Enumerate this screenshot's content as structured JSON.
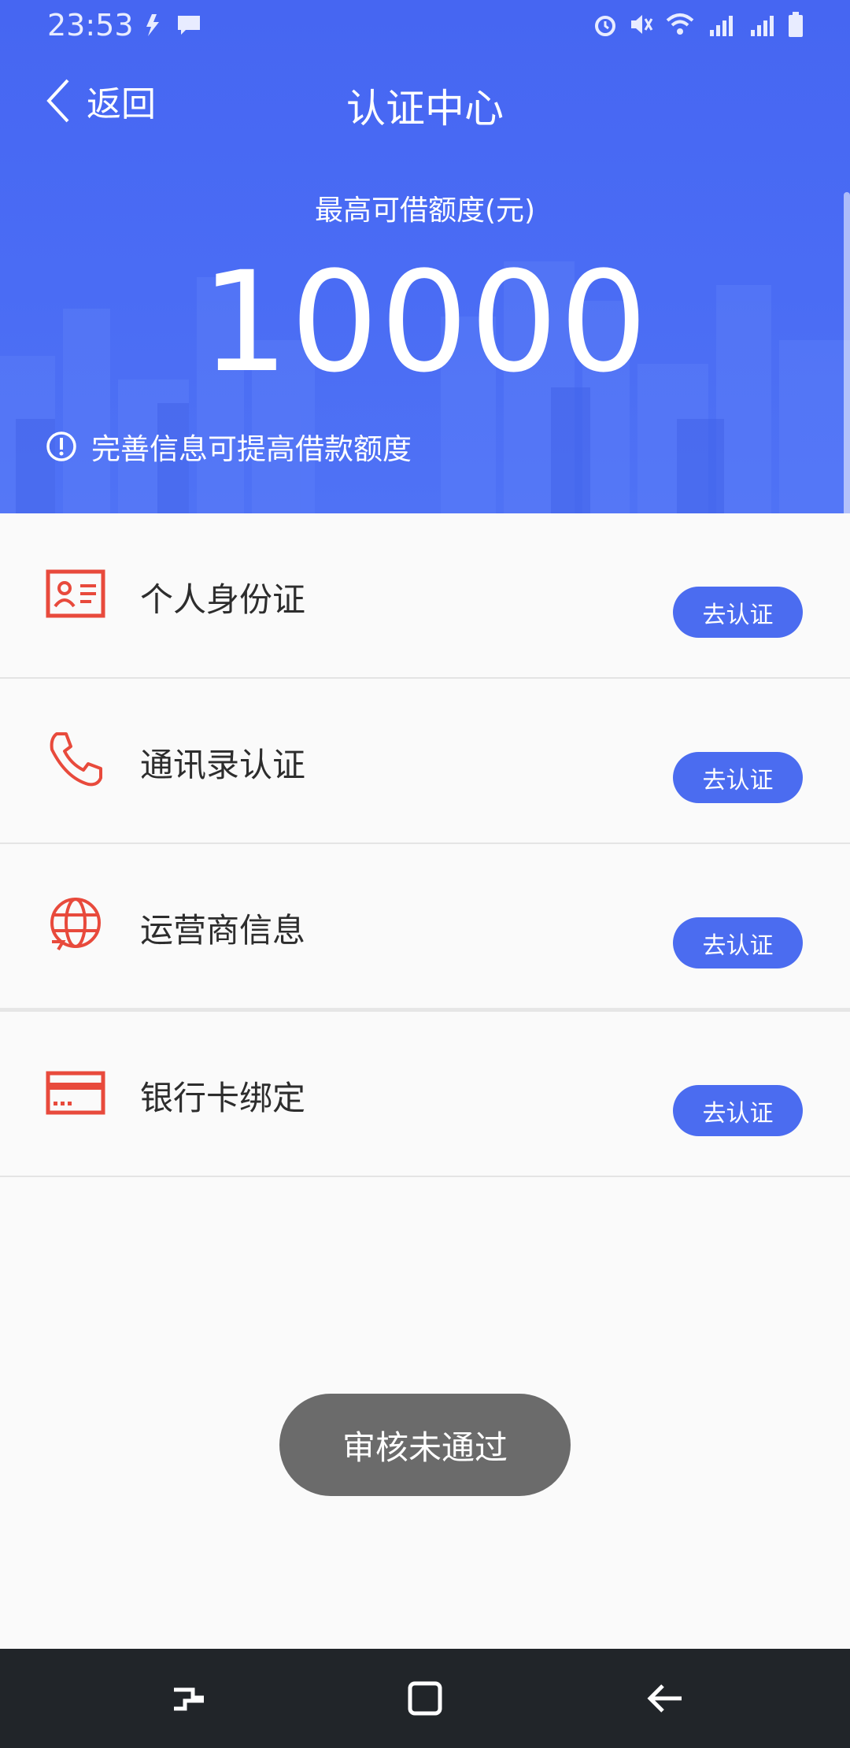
{
  "status_bar": {
    "time": "23:53"
  },
  "nav": {
    "back_label": "返回",
    "title": "认证中心"
  },
  "hero": {
    "limit_label": "最高可借额度(元)",
    "limit_value": "10000",
    "hint": "完善信息可提高借款额度"
  },
  "items": [
    {
      "label": "个人身份证",
      "button": "去认证",
      "icon": "id-card-icon"
    },
    {
      "label": "通讯录认证",
      "button": "去认证",
      "icon": "phone-icon"
    },
    {
      "label": "运营商信息",
      "button": "去认证",
      "icon": "globe-icon"
    },
    {
      "label": "银行卡绑定",
      "button": "去认证",
      "icon": "bank-card-icon"
    }
  ],
  "toast": "审核未通过",
  "colors": {
    "primary": "#4b6cf0",
    "icon_red": "#e84a3c",
    "hero_blue": "#4a6cf4"
  }
}
